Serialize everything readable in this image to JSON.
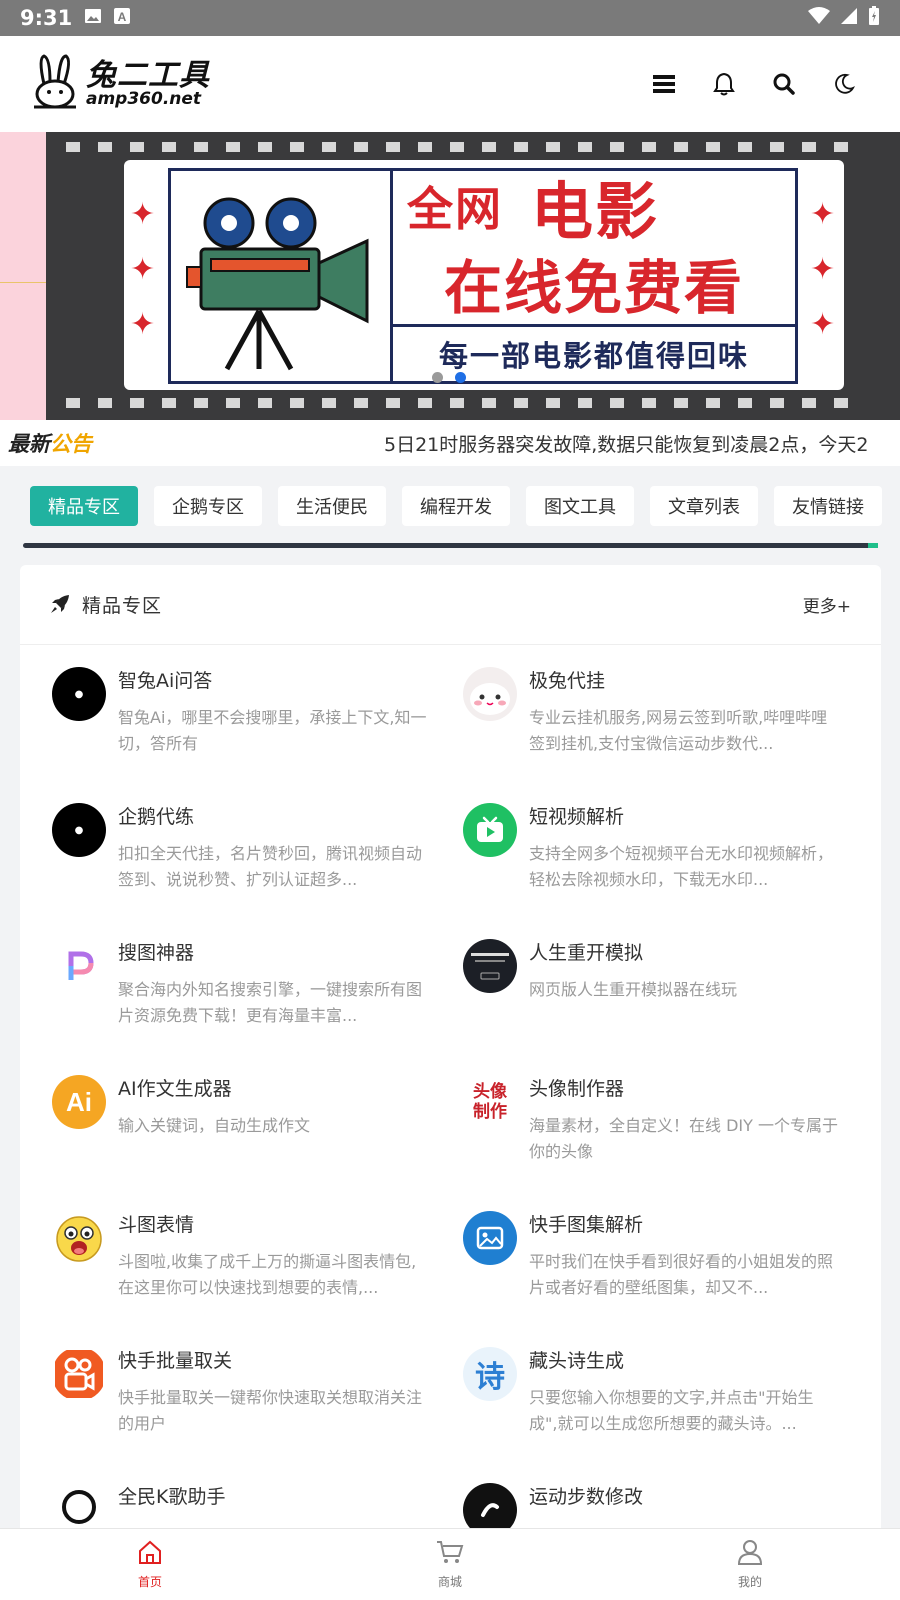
{
  "status_bar": {
    "time": "9:31"
  },
  "header": {
    "logo_cn": "兔二工具",
    "logo_en": "amp360.net"
  },
  "banner": {
    "line1a": "全网",
    "line1b": "电影",
    "line2": "在线免费看",
    "line3": "每一部电影都值得回味",
    "slide_count": 2,
    "active_slide": 1
  },
  "notice": {
    "tag_a": "最新",
    "tag_b": "公告",
    "message": "5日21时服务器突发故障,数据只能恢复到凌晨2点，今天2"
  },
  "tabs": [
    {
      "label": "精品专区",
      "active": true
    },
    {
      "label": "企鹅专区",
      "active": false
    },
    {
      "label": "生活便民",
      "active": false
    },
    {
      "label": "编程开发",
      "active": false
    },
    {
      "label": "图文工具",
      "active": false
    },
    {
      "label": "文章列表",
      "active": false
    },
    {
      "label": "友情链接",
      "active": false
    }
  ],
  "section": {
    "title": "精品专区",
    "more": "更多+"
  },
  "items": [
    {
      "name": "智兔Ai问答",
      "desc": "智兔Ai，哪里不会搜哪里，承接上下文,知一切，答所有",
      "icon": "black-circle-icon"
    },
    {
      "name": "极兔代挂",
      "desc": "专业云挂机服务,网易云签到听歌,哔哩哔哩签到挂机,支付宝微信运动步数代...",
      "icon": "rabbit-face-icon"
    },
    {
      "name": "企鹅代练",
      "desc": "扣扣全天代挂，名片赞秒回，腾讯视频自动签到、说说秒赞、扩列认证超多...",
      "icon": "black-circle-icon"
    },
    {
      "name": "短视频解析",
      "desc": "支持全网多个短视频平台无水印视频解析，轻松去除视频水印，下载无水印...",
      "icon": "tv-play-icon"
    },
    {
      "name": "搜图神器",
      "desc": "聚合海内外知名搜索引擎，一键搜索所有图片资源免费下载！更有海量丰富...",
      "icon": "p-letter-icon"
    },
    {
      "name": "人生重开模拟",
      "desc": "网页版人生重开模拟器在线玩",
      "icon": "game-thumbnail-icon"
    },
    {
      "name": "AI作文生成器",
      "desc": "输入关键词，自动生成作文",
      "icon": "ai-badge-icon",
      "badge": "Ai"
    },
    {
      "name": "头像制作器",
      "desc": "海量素材，全自定义！在线 DIY 一个专属于你的头像",
      "icon": "avatar-maker-icon",
      "badge": "头像制作"
    },
    {
      "name": "斗图表情",
      "desc": "斗图啦,收集了成千上万的撕逼斗图表情包,在这里你可以快速找到想要的表情,...",
      "icon": "emoji-face-icon"
    },
    {
      "name": "快手图集解析",
      "desc": "平时我们在快手看到很好看的小姐姐发的照片或者好看的壁纸图集，却又不...",
      "icon": "image-gallery-icon"
    },
    {
      "name": "快手批量取关",
      "desc": "快手批量取关一键帮你快速取关想取消关注的用户",
      "icon": "kuaishou-icon"
    },
    {
      "name": "藏头诗生成",
      "desc": "只要您输入你想要的文字,并点击\"开始生成\",就可以生成您所想要的藏头诗。...",
      "icon": "poem-icon",
      "badge": "诗"
    },
    {
      "name": "全民K歌助手",
      "desc": "",
      "icon": "karaoke-icon"
    },
    {
      "name": "运动步数修改",
      "desc": "",
      "icon": "steps-icon"
    }
  ],
  "bottom_nav": [
    {
      "label": "首页",
      "icon": "home-icon",
      "active": true
    },
    {
      "label": "商城",
      "icon": "cart-icon",
      "active": false
    },
    {
      "label": "我的",
      "icon": "user-icon",
      "active": false
    }
  ]
}
